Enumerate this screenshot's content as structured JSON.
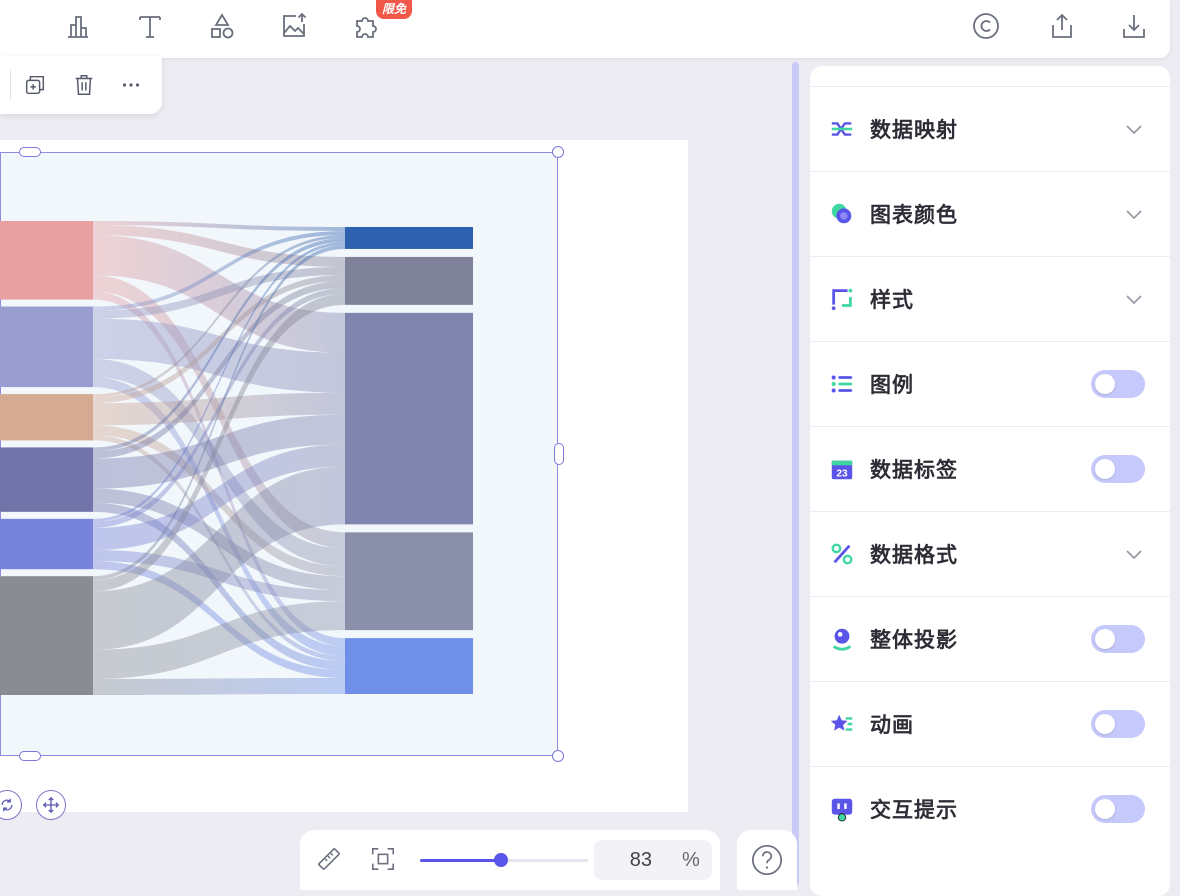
{
  "toolbar": {
    "badge_free": "限免",
    "left_icons": [
      "bar-chart-icon",
      "text-icon",
      "shapes-icon",
      "image-upload-icon",
      "plugin-icon"
    ],
    "right_icons": [
      "copyright-icon",
      "share-icon",
      "download-icon"
    ]
  },
  "element_toolbar": {
    "icons": [
      "duplicate-icon",
      "delete-icon",
      "more-icon"
    ]
  },
  "panel": {
    "rows": [
      {
        "label": "数据映射",
        "control": "chevron",
        "icon": "data-mapping-icon"
      },
      {
        "label": "图表颜色",
        "control": "chevron",
        "icon": "chart-color-icon"
      },
      {
        "label": "样式",
        "control": "chevron",
        "icon": "style-icon"
      },
      {
        "label": "图例",
        "control": "toggle",
        "on": false,
        "icon": "legend-icon"
      },
      {
        "label": "数据标签",
        "control": "toggle",
        "on": false,
        "icon": "data-label-icon"
      },
      {
        "label": "数据格式",
        "control": "chevron",
        "icon": "data-format-icon"
      },
      {
        "label": "整体投影",
        "control": "toggle",
        "on": false,
        "icon": "shadow-icon"
      },
      {
        "label": "动画",
        "control": "toggle",
        "on": false,
        "icon": "animation-icon"
      },
      {
        "label": "交互提示",
        "control": "toggle",
        "on": false,
        "icon": "tooltip-icon"
      }
    ]
  },
  "zoom": {
    "value": "83",
    "unit": "%",
    "slider_fraction": 0.48
  },
  "colors": {
    "accent": "#5b54e8",
    "toggle_off": "#c6c9fb"
  },
  "chart_data": {
    "type": "sankey",
    "sources": [
      {
        "value": 78,
        "color": "#e8a0a0"
      },
      {
        "value": 80,
        "color": "#9a9dcf"
      },
      {
        "value": 46,
        "color": "#d5aa92"
      },
      {
        "value": 64,
        "color": "#7274a9"
      },
      {
        "value": 50,
        "color": "#7883dc"
      },
      {
        "value": 118,
        "color": "#8a8c94"
      }
    ],
    "targets": [
      {
        "value": 22,
        "color": "#2e62b0"
      },
      {
        "value": 48,
        "color": "#7e8197"
      },
      {
        "value": 212,
        "color": "#8085b0"
      },
      {
        "value": 98,
        "color": "#8a90aa"
      },
      {
        "value": 56,
        "color": "#6f8fe8"
      }
    ],
    "links": [
      [
        0,
        0,
        4
      ],
      [
        0,
        1,
        10
      ],
      [
        0,
        2,
        40
      ],
      [
        0,
        3,
        16
      ],
      [
        0,
        4,
        8
      ],
      [
        1,
        0,
        4
      ],
      [
        1,
        1,
        8
      ],
      [
        1,
        2,
        40
      ],
      [
        1,
        3,
        18
      ],
      [
        1,
        4,
        10
      ],
      [
        2,
        0,
        3
      ],
      [
        2,
        1,
        6
      ],
      [
        2,
        2,
        22
      ],
      [
        2,
        3,
        10
      ],
      [
        2,
        4,
        5
      ],
      [
        3,
        0,
        4
      ],
      [
        3,
        1,
        7
      ],
      [
        3,
        2,
        30
      ],
      [
        3,
        3,
        14
      ],
      [
        3,
        4,
        9
      ],
      [
        4,
        0,
        3
      ],
      [
        4,
        1,
        6
      ],
      [
        4,
        2,
        22
      ],
      [
        4,
        3,
        11
      ],
      [
        4,
        4,
        8
      ],
      [
        5,
        0,
        4
      ],
      [
        5,
        1,
        11
      ],
      [
        5,
        2,
        58
      ],
      [
        5,
        3,
        29
      ],
      [
        5,
        4,
        16
      ]
    ]
  }
}
